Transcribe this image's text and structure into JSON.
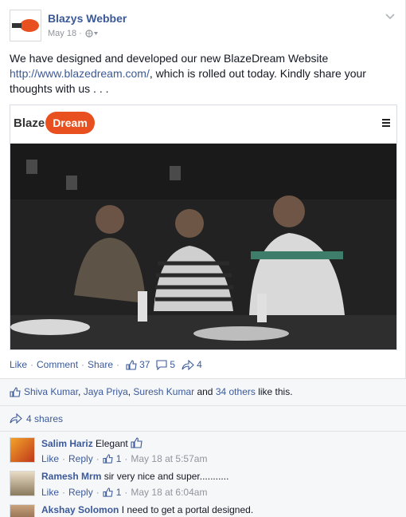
{
  "post": {
    "author": "Blazys Webber",
    "date": "May 18 ·",
    "text_before": "We have designed and developed our new BlazeDream Website ",
    "link": "http://www.blazedream.com/",
    "text_after": ", which is rolled out today. Kindly share your thoughts with us . . ."
  },
  "attachment": {
    "brand_blaze": "Blaze",
    "brand_dream": "Dream"
  },
  "actions": {
    "like": "Like",
    "comment": "Comment",
    "share": "Share",
    "likes_count": "37",
    "comments_count": "5",
    "shares_count": "4"
  },
  "likes_summary": {
    "names": [
      "Shiva Kumar",
      "Jaya Priya",
      "Suresh Kumar"
    ],
    "and": " and ",
    "others": "34 others",
    "tail": " like this."
  },
  "shares": {
    "label": "4 shares"
  },
  "comments": [
    {
      "name": "Salim Hariz",
      "text": "Elegant",
      "like": "Like",
      "reply": "Reply",
      "likes": "1",
      "time": "May 18 at 5:57am"
    },
    {
      "name": "Ramesh Mrm",
      "text": "sir very nice and super...........",
      "like": "Like",
      "reply": "Reply",
      "likes": "1",
      "time": "May 18 at 6:04am"
    },
    {
      "name": "Akshay Solomon",
      "text": "I need to get a portal designed."
    }
  ],
  "colors": {
    "link": "#3b5998",
    "brand_orange": "#e8511f",
    "meta_gray": "#90949c"
  }
}
